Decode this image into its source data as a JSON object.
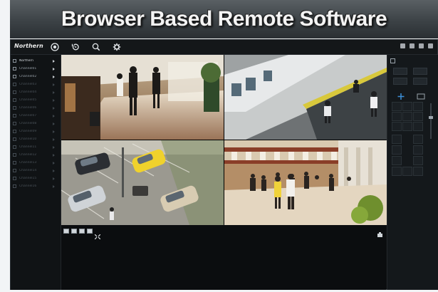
{
  "banner": {
    "title": "Browser Based Remote Software"
  },
  "app": {
    "brand": "Northern",
    "toolbar": [
      "live-view-icon",
      "playback-icon",
      "search-icon",
      "settings-icon"
    ],
    "sidebar": {
      "items": [
        {
          "label": "Northern",
          "state": "top"
        },
        {
          "label": "Channel01",
          "state": "active"
        },
        {
          "label": "Channel02",
          "state": "active"
        },
        {
          "label": "Channel03",
          "state": "dim"
        },
        {
          "label": "Channel04",
          "state": "dim"
        },
        {
          "label": "Channel05",
          "state": "dim"
        },
        {
          "label": "Channel06",
          "state": "dim"
        },
        {
          "label": "Channel07",
          "state": "dim"
        },
        {
          "label": "Channel08",
          "state": "dim"
        },
        {
          "label": "Channel09",
          "state": "dim"
        },
        {
          "label": "Channel10",
          "state": "dim"
        },
        {
          "label": "Channel11",
          "state": "dim"
        },
        {
          "label": "Channel12",
          "state": "dim"
        },
        {
          "label": "Channel13",
          "state": "dim"
        },
        {
          "label": "Channel14",
          "state": "dim"
        },
        {
          "label": "Channel15",
          "state": "dim"
        },
        {
          "label": "Channel16",
          "state": "dim"
        }
      ]
    },
    "cameras": [
      "camera-mall-walkway",
      "camera-subway-platform",
      "camera-parking-lot",
      "camera-atrium-crowd"
    ],
    "layout_buttons": [
      "layout-1x1",
      "layout-2x2",
      "layout-3x3",
      "layout-4x4",
      "fullscreen"
    ],
    "colors": {
      "accent": "#3b8fd8",
      "background": "#0e1012"
    }
  }
}
